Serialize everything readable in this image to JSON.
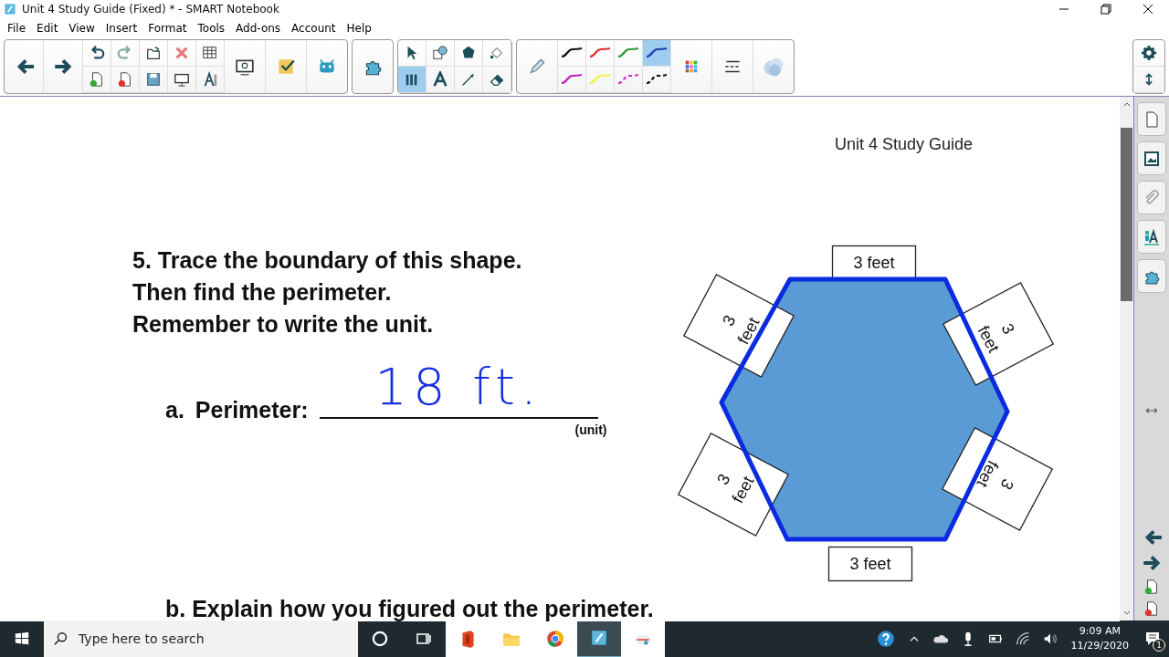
{
  "window": {
    "title": "Unit 4 Study Guide (Fixed) * - SMART Notebook"
  },
  "menu": [
    "File",
    "Edit",
    "View",
    "Insert",
    "Format",
    "Tools",
    "Add-ons",
    "Account",
    "Help"
  ],
  "tools": [
    {
      "kind": "select",
      "selected": false
    },
    {
      "kind": "shapes",
      "selected": false
    },
    {
      "kind": "polygon",
      "selected": false
    },
    {
      "kind": "fill",
      "selected": false
    },
    {
      "kind": "pens",
      "selected": true
    },
    {
      "kind": "text",
      "selected": false
    },
    {
      "kind": "line",
      "selected": false
    },
    {
      "kind": "eraser",
      "selected": false
    }
  ],
  "pen_styles": [
    {
      "kind": "solid",
      "color": "#111111",
      "selected": false
    },
    {
      "kind": "solid",
      "color": "#e03030",
      "selected": false
    },
    {
      "kind": "solid",
      "color": "#2e9a3a",
      "selected": false
    },
    {
      "kind": "solid",
      "color": "#1f3fb0",
      "selected": true
    },
    {
      "kind": "solid",
      "color": "#c020c0",
      "selected": false
    },
    {
      "kind": "solid",
      "color": "#f0f040",
      "selected": false
    },
    {
      "kind": "dashed",
      "color": "#d030d0",
      "selected": false
    },
    {
      "kind": "dashed",
      "color": "#111111",
      "selected": false
    }
  ],
  "page": {
    "header": "Unit 4 Study Guide",
    "question": [
      "5. Trace the boundary of this shape.",
      "Then find the perimeter.",
      "Remember to write the unit."
    ],
    "item_letter": "a.",
    "perimeter_label": "Perimeter:",
    "answer": "18 ft.",
    "unit_hint": "(unit)",
    "side_labels": [
      {
        "lines": [
          "3 feet"
        ]
      },
      {
        "lines": [
          "3",
          "feet"
        ]
      },
      {
        "lines": [
          "3",
          "feet"
        ]
      },
      {
        "lines": [
          "3",
          "feet"
        ]
      },
      {
        "lines": [
          "3",
          "feet"
        ]
      },
      {
        "lines": [
          "3 feet"
        ]
      }
    ],
    "next_question": "b. Explain how you figured out the perimeter."
  },
  "taskbar": {
    "search_placeholder": "Type here to search",
    "time": "9:09 AM",
    "date": "11/29/2020",
    "notifications": "1"
  }
}
